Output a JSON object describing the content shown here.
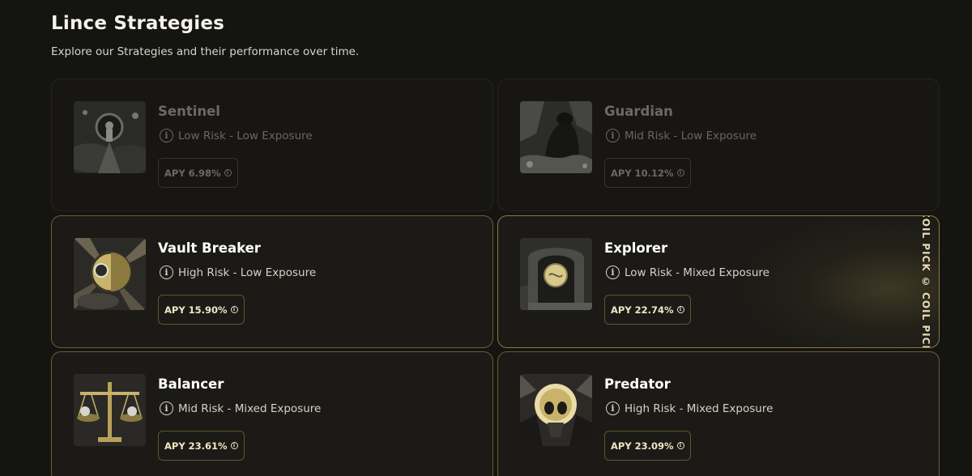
{
  "header": {
    "title": "Lince Strategies",
    "subtitle": "Explore our Strategies and their performance over time."
  },
  "strategies": [
    {
      "name": "Sentinel",
      "risk": "Low Risk - Low Exposure",
      "apy": "APY 6.98%",
      "image": "keyhole-icon",
      "dimmed": true
    },
    {
      "name": "Guardian",
      "risk": "Mid Risk - Low Exposure",
      "apy": "APY 10.12%",
      "image": "panther-icon",
      "dimmed": true
    },
    {
      "name": "Vault Breaker",
      "risk": "High Risk - Low Exposure",
      "apy": "APY 15.90%",
      "image": "vault-door-icon",
      "dimmed": false
    },
    {
      "name": "Explorer",
      "risk": "Low Risk - Mixed Exposure",
      "apy": "APY 22.74%",
      "image": "portal-icon",
      "dimmed": false,
      "ribbon": "COIL PICK © COIL PICK"
    },
    {
      "name": "Balancer",
      "risk": "Mid Risk - Mixed Exposure",
      "apy": "APY 23.61%",
      "image": "scales-icon",
      "dimmed": false
    },
    {
      "name": "Predator",
      "risk": "High Risk - Mixed Exposure",
      "apy": "APY 23.09%",
      "image": "skull-icon",
      "dimmed": false
    }
  ],
  "colors": {
    "background": "#141411",
    "card": "#1b1a16",
    "accent": "#c9a84c",
    "apy_text": "#f0e6c4"
  }
}
